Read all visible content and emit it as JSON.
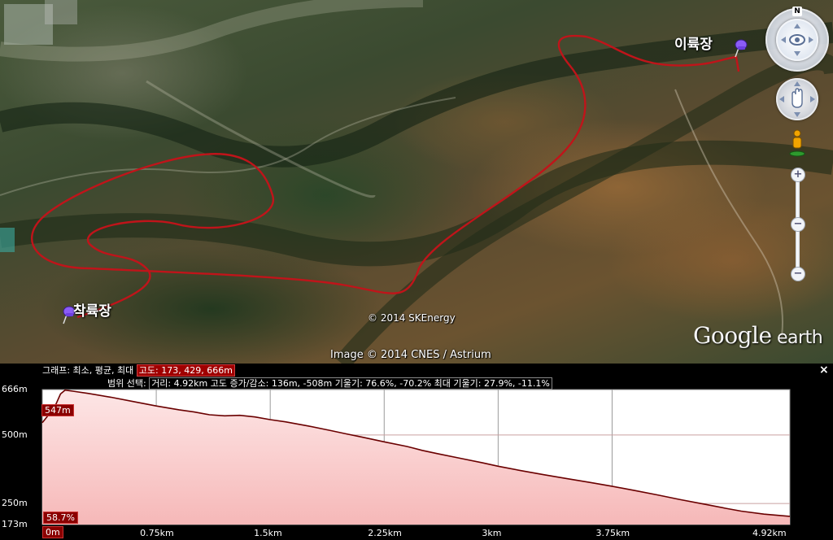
{
  "map": {
    "start_label": "착륙장",
    "end_label": "이륙장",
    "copyright_1": "© 2014 SKEnergy",
    "copyright_2": "Image © 2014 CNES / Astrium",
    "watermark_google": "Google",
    "watermark_earth": " earth",
    "compass_letter": "N",
    "track_color": "#c0141a"
  },
  "profile": {
    "line1_prefix": "그래프: 최소, 평균, 최대",
    "line1_box": "고도: 173, 429, 666m",
    "line2_prefix": "범위 선택:",
    "line2_dist": "거리: 4.92km",
    "line2_alt": "고도 증가/감소: 136m, -508m",
    "line2_slope": "기울기: 76.6%, -70.2%",
    "line2_max_slope": "최대 기울기: 27.9%, -11.1%",
    "close_label": "×",
    "tag_top": "547m",
    "tag_slope": "58.7%",
    "tag_origin": "0m"
  },
  "chart_data": {
    "type": "area",
    "xlabel": "",
    "ylabel": "",
    "x_unit": "km",
    "y_unit": "m",
    "xlim": [
      0,
      4.92
    ],
    "ylim": [
      173,
      666
    ],
    "y_ticks": [
      "666m",
      "500m",
      "250m",
      "173m"
    ],
    "y_tick_values": [
      666,
      500,
      250,
      173
    ],
    "x_ticks": [
      "0m",
      "0.75km",
      "1.5km",
      "2.25km",
      "3km",
      "3.75km",
      "4.92km"
    ],
    "x_tick_values": [
      0,
      0.75,
      1.5,
      2.25,
      3.0,
      3.75,
      4.92
    ],
    "line_color": "#6a0000",
    "fill_color": "#f6b8b8",
    "series": [
      {
        "x": [
          0.0,
          0.08,
          0.12,
          0.15,
          0.2,
          0.3,
          0.45,
          0.6,
          0.75,
          0.9,
          1.0,
          1.1,
          1.2,
          1.3,
          1.4,
          1.5,
          1.6,
          1.75,
          1.9,
          2.0,
          2.1,
          2.25,
          2.4,
          2.5,
          2.6,
          2.75,
          2.9,
          3.0,
          3.15,
          3.3,
          3.45,
          3.6,
          3.75,
          3.9,
          4.05,
          4.2,
          4.35,
          4.5,
          4.6,
          4.75,
          4.92
        ],
        "y": [
          545,
          600,
          650,
          664,
          660,
          652,
          638,
          622,
          606,
          592,
          584,
          574,
          570,
          572,
          566,
          556,
          548,
          533,
          516,
          504,
          493,
          475,
          458,
          444,
          432,
          415,
          398,
          386,
          370,
          355,
          341,
          327,
          313,
          297,
          281,
          264,
          248,
          232,
          222,
          211,
          203
        ]
      }
    ]
  }
}
